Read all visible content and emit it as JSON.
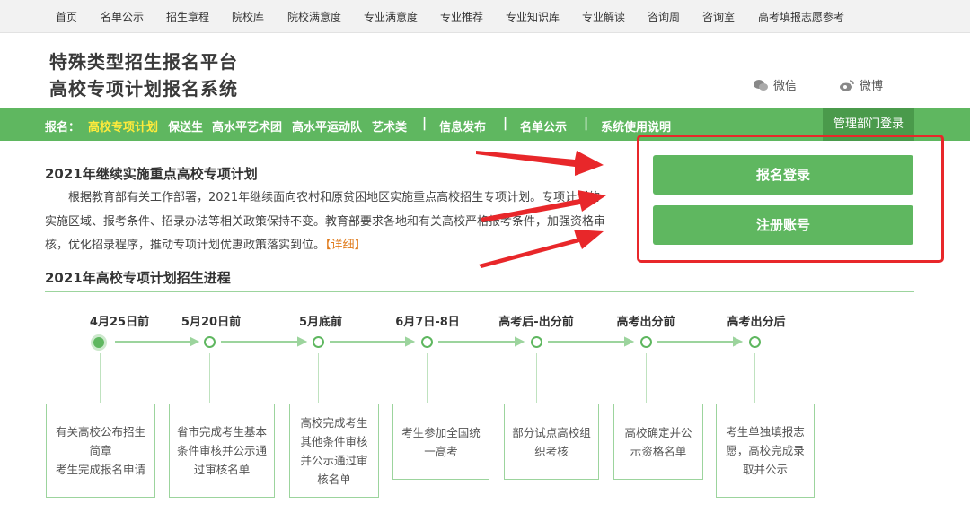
{
  "topnav": [
    "首页",
    "名单公示",
    "招生章程",
    "院校库",
    "院校满意度",
    "专业满意度",
    "专业推荐",
    "专业知识库",
    "专业解读",
    "咨询周",
    "咨询室",
    "高考填报志愿参考"
  ],
  "header": {
    "title_line1": "特殊类型招生报名平台",
    "title_line2": "高校专项计划报名系统",
    "wechat": "微信",
    "weibo": "微博"
  },
  "greenbar": {
    "label": "报名：",
    "links": [
      "高校专项计划",
      "保送生",
      "高水平艺术团",
      "高水平运动队",
      "艺术类"
    ],
    "separator": "|",
    "info": "信息发布",
    "names": "名单公示",
    "help": "系统使用说明",
    "admin": "管理部门登录"
  },
  "intro": {
    "title": "2021年继续实施重点高校专项计划",
    "text": "根据教育部有关工作部署，2021年继续面向农村和原贫困地区实施重点高校招生专项计划。专项计划的实施区域、报考条件、招录办法等相关政策保持不变。教育部要求各地和有关高校严格报考条件，加强资格审核，优化招录程序，推动专项计划优惠政策落实到位。",
    "more": "【详细】"
  },
  "panel": {
    "login": "报名登录",
    "register": "注册账号"
  },
  "timeline": {
    "title": "2021年高校专项计划招生进程",
    "steps": [
      {
        "date": "4月25日前",
        "desc": "有关高校公布招生简章\n考生完成报名申请"
      },
      {
        "date": "5月20日前",
        "desc": "省市完成考生基本条件审核并公示通过审核名单"
      },
      {
        "date": "5月底前",
        "desc": "高校完成考生其他条件审核并公示通过审核名单"
      },
      {
        "date": "6月7日-8日",
        "desc": "考生参加全国统一高考"
      },
      {
        "date": "高考后-出分前",
        "desc": "部分试点高校组织考核"
      },
      {
        "date": "高考出分前",
        "desc": "高校确定并公示资格名单"
      },
      {
        "date": "高考出分后",
        "desc": "考生单独填报志愿，高校完成录取并公示"
      }
    ]
  },
  "colors": {
    "green": "#5fb760",
    "red": "#e8272a",
    "accent": "#ffeb3b"
  }
}
